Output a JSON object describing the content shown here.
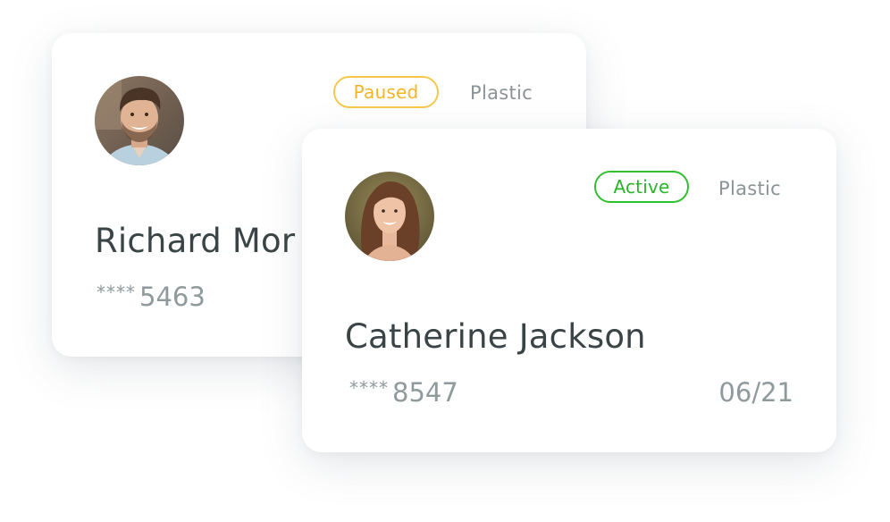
{
  "cards": [
    {
      "holder_name": "Richard Mor",
      "status": "Paused",
      "type": "Plastic",
      "number_mask": "****",
      "number_last4": "5463",
      "status_color": "#f2b625"
    },
    {
      "holder_name": "Catherine Jackson",
      "status": "Active",
      "type": "Plastic",
      "number_mask": "****",
      "number_last4": "8547",
      "expiry": "06/21",
      "status_color": "#2bb32b"
    }
  ]
}
